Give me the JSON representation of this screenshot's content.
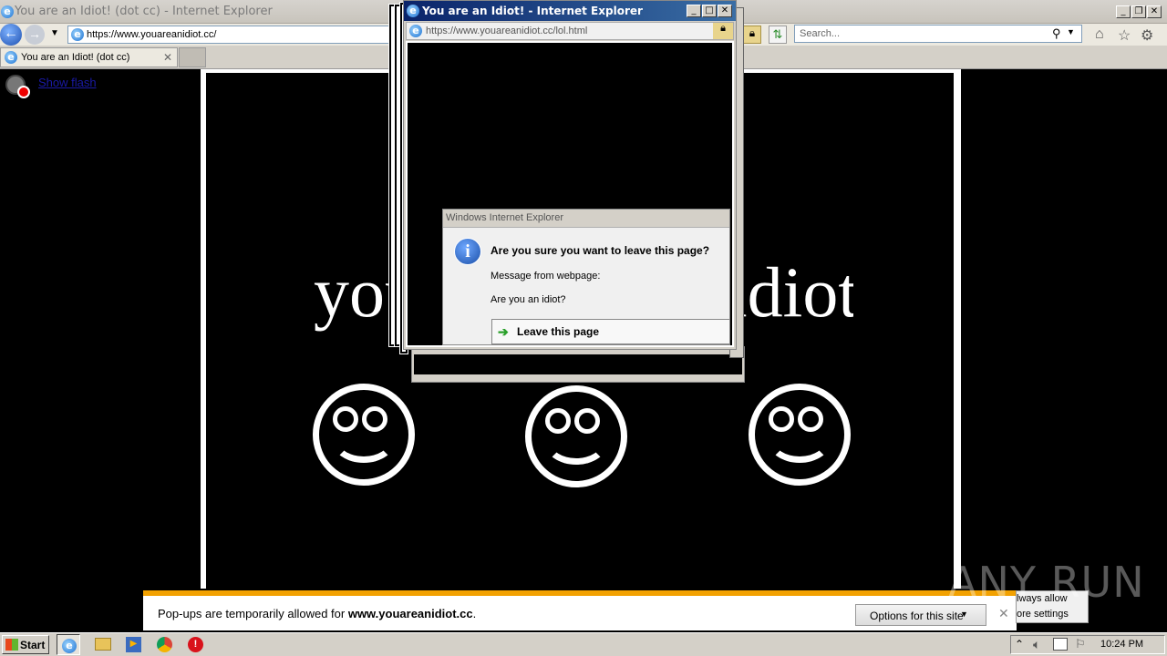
{
  "main_window": {
    "title": "You are an Idiot! (dot cc) - Internet Explorer",
    "url": "https://www.youareanidiot.cc/",
    "search_placeholder": "Search...",
    "tab_label": "You are an Idiot! (dot cc)"
  },
  "page": {
    "flash_link": "Show flash",
    "headline_left": "you",
    "headline_right": "idiot"
  },
  "popup": {
    "title": "You are an Idiot! - Internet Explorer",
    "url": "https://www.youareanidiot.cc/lol.html"
  },
  "dialog": {
    "title": "Windows Internet Explorer",
    "question": "Are you sure you want to leave this page?",
    "message_label": "Message from webpage:",
    "message": "Are you an idiot?",
    "leave_label": "Leave this page"
  },
  "notification": {
    "text_prefix": "Pop-ups are temporarily allowed for ",
    "domain": "www.youareanidiot.cc",
    "text_suffix": ".",
    "options_label": "Options for this site",
    "menu_items": [
      "lways allow",
      "ore settings"
    ]
  },
  "taskbar": {
    "start_label": "Start",
    "clock": "10:24 PM"
  },
  "watermark": "ANY RUN",
  "colors": {
    "accent": "#f2a100",
    "titlebar_active": "#0a246a"
  }
}
